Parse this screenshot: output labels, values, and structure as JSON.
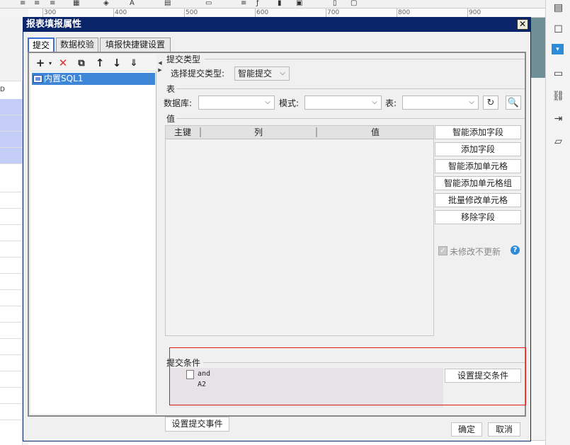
{
  "ruler": {
    "marks": [
      "300",
      "400",
      "500",
      "600",
      "700",
      "800",
      "900"
    ]
  },
  "background": {
    "column_letter": "D"
  },
  "dialog": {
    "title": "报表填报属性",
    "close_glyph": "✕",
    "tabs": [
      {
        "label": "提交"
      },
      {
        "label": "数据校验"
      },
      {
        "label": "填报快捷键设置"
      }
    ],
    "tree": {
      "items": [
        {
          "label": "内置SQL1"
        }
      ]
    },
    "submit_type": {
      "section": "提交类型",
      "label": "选择提交类型:",
      "value": "智能提交"
    },
    "table_section": {
      "section": "表",
      "database_label": "数据库:",
      "database_value": "",
      "schema_label": "模式:",
      "schema_value": "",
      "table_label": "表:",
      "table_value": ""
    },
    "values_section": {
      "section": "值",
      "columns": [
        "主键",
        "列",
        "值"
      ],
      "buttons": [
        "智能添加字段",
        "添加字段",
        "智能添加单元格",
        "智能添加单元格组",
        "批量修改单元格",
        "移除字段"
      ],
      "checkbox_label": "未修改不更新",
      "checkbox_checked": true
    },
    "condition_section": {
      "section": "提交条件",
      "items": [
        "and A2"
      ],
      "button": "设置提交条件"
    },
    "event_button": "设置提交事件",
    "ok_button": "确定",
    "cancel_button": "取消",
    "accent_color": "#0a246a",
    "highlight_color": "#e01b1b"
  }
}
